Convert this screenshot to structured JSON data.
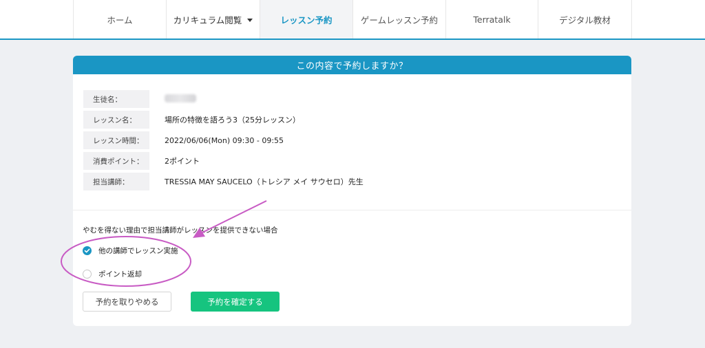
{
  "nav": {
    "items": [
      {
        "label": "ホーム",
        "active": false
      },
      {
        "label": "カリキュラム閲覧",
        "active": false,
        "dropdown": true
      },
      {
        "label": "レッスン予約",
        "active": true
      },
      {
        "label": "ゲームレッスン予約",
        "active": false
      },
      {
        "label": "Terratalk",
        "active": false
      },
      {
        "label": "デジタル教材",
        "active": false
      }
    ]
  },
  "confirm": {
    "title": "この内容で予約しますか？",
    "rows": [
      {
        "label": "生徒名：",
        "value": ""
      },
      {
        "label": "レッスン名：",
        "value": "場所の特徴を語ろう3（25分レッスン）"
      },
      {
        "label": "レッスン時間：",
        "value": "2022/06/06(Mon) 09:30 - 09:55"
      },
      {
        "label": "消費ポイント：",
        "value": "2ポイント"
      },
      {
        "label": "担当講師：",
        "value": "TRESSIA MAY SAUCELO（トレシア メイ サウセロ）先生"
      }
    ],
    "policy_text": "やむを得ない理由で担当講師がレッスンを提供できない場合",
    "options": [
      {
        "label": "他の講師でレッスン実施",
        "checked": true
      },
      {
        "label": "ポイント返却",
        "checked": false
      }
    ],
    "cancel_label": "予約を取りやめる",
    "confirm_label": "予約を確定する"
  },
  "colors": {
    "accent": "#1a96c4",
    "confirm_button": "#16c47f",
    "annotation": "#c85bc4"
  }
}
